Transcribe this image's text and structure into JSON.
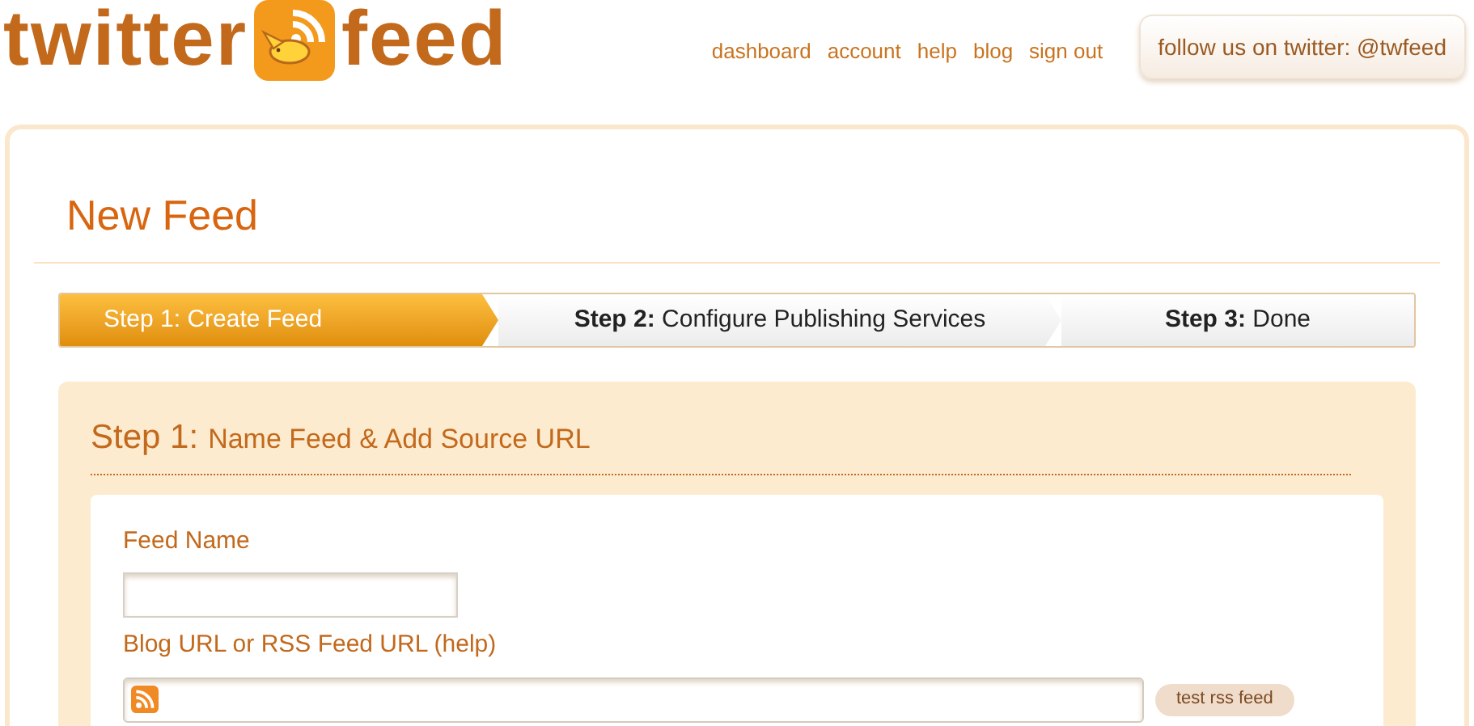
{
  "logo": {
    "word_1": "twitter",
    "word_2": "feed"
  },
  "nav": [
    "dashboard",
    "account",
    "help",
    "blog",
    "sign out"
  ],
  "follow_button": "follow us on twitter: @twfeed",
  "page_title": "New Feed",
  "steps": [
    {
      "label": "Step 1: Create Feed",
      "selected": true
    },
    {
      "label": "**Step 2:** Configure Publishing Services",
      "selected": false
    },
    {
      "label": "**Step 3:** Done",
      "selected": false
    }
  ],
  "section": {
    "number": "Step 1:",
    "title": "Name Feed & Add Source URL"
  },
  "fields": [
    {
      "label": "Feed Name",
      "kind": "short"
    },
    {
      "label": "Blog URL or RSS Feed URL (help)",
      "kind": "rss",
      "button": "test rss feed"
    }
  ]
}
